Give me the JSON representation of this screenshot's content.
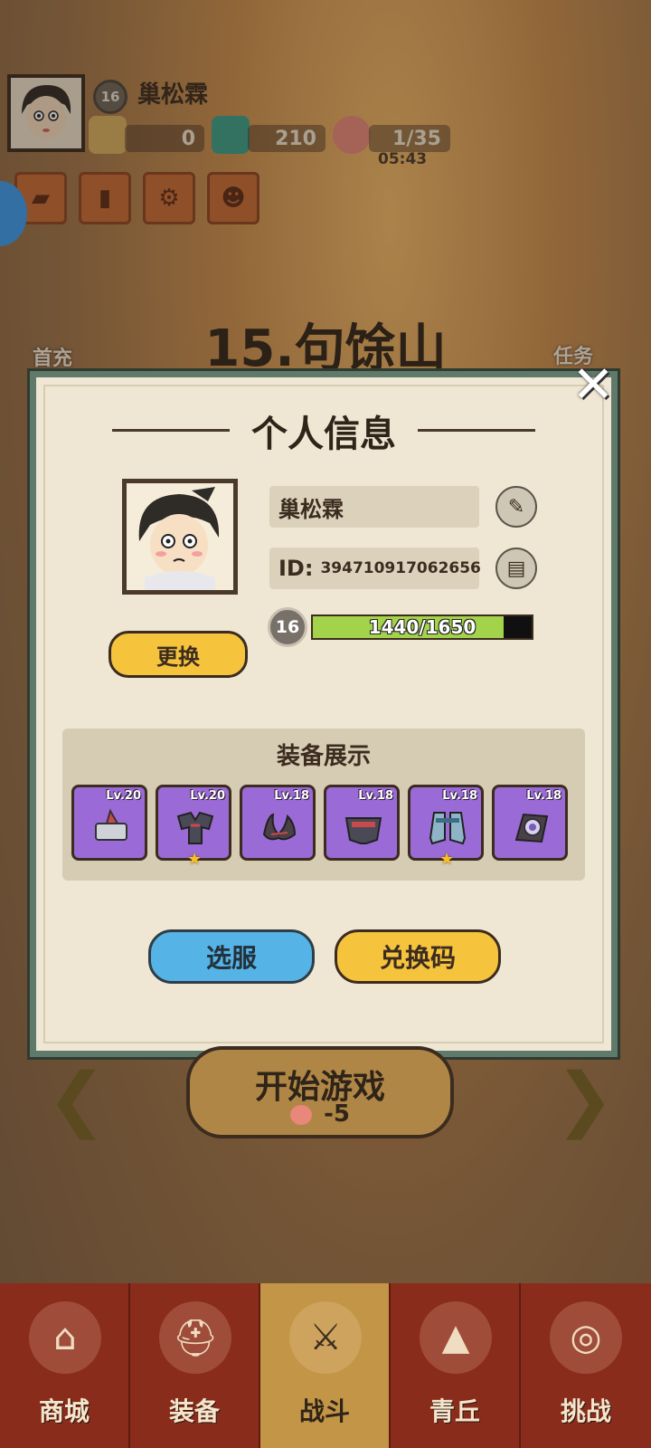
{
  "player": {
    "level": "16",
    "name": "巢松霖",
    "resources": {
      "coins": "0",
      "gems": "210",
      "stamina": "1/35",
      "timer": "05:43"
    }
  },
  "stage": {
    "title": "15.句馀山"
  },
  "side_labels": {
    "first_charge": "首充",
    "tasks": "任务"
  },
  "dialog": {
    "title": "个人信息",
    "name": "巢松霖",
    "id_label": "ID:",
    "id_value": "394710917062656",
    "level": "16",
    "xp_text": "1440/1650",
    "xp_current": 1440,
    "xp_max": 1650,
    "change_button": "更换",
    "equip_title": "装备展示",
    "equipment": [
      {
        "lv": "Lv.20",
        "icon": "hammer-icon",
        "starred": false
      },
      {
        "lv": "Lv.20",
        "icon": "armor-icon",
        "starred": true
      },
      {
        "lv": "Lv.18",
        "icon": "horns-icon",
        "starred": false
      },
      {
        "lv": "Lv.18",
        "icon": "belt-icon",
        "starred": false
      },
      {
        "lv": "Lv.18",
        "icon": "boots-icon",
        "starred": true
      },
      {
        "lv": "Lv.18",
        "icon": "orb-icon",
        "starred": false
      }
    ],
    "server_button": "选服",
    "redeem_button": "兑换码"
  },
  "start": {
    "label": "开始游戏",
    "cost": "-5"
  },
  "tabs": [
    {
      "label": "商城",
      "icon": "shop-icon"
    },
    {
      "label": "装备",
      "icon": "helmet-icon"
    },
    {
      "label": "战斗",
      "icon": "crossed-swords-icon",
      "active": true
    },
    {
      "label": "青丘",
      "icon": "mountain-icon"
    },
    {
      "label": "挑战",
      "icon": "challenge-icon"
    }
  ],
  "colors": {
    "dialog_bg": "#efe7d4",
    "dialog_border": "#5f7a6a",
    "accent_yellow": "#f6c33d",
    "accent_blue": "#55b3e6",
    "equip_purple": "#9a6bd6",
    "xp_green": "#a3d34a",
    "tabbar": "#8a2c1c"
  }
}
